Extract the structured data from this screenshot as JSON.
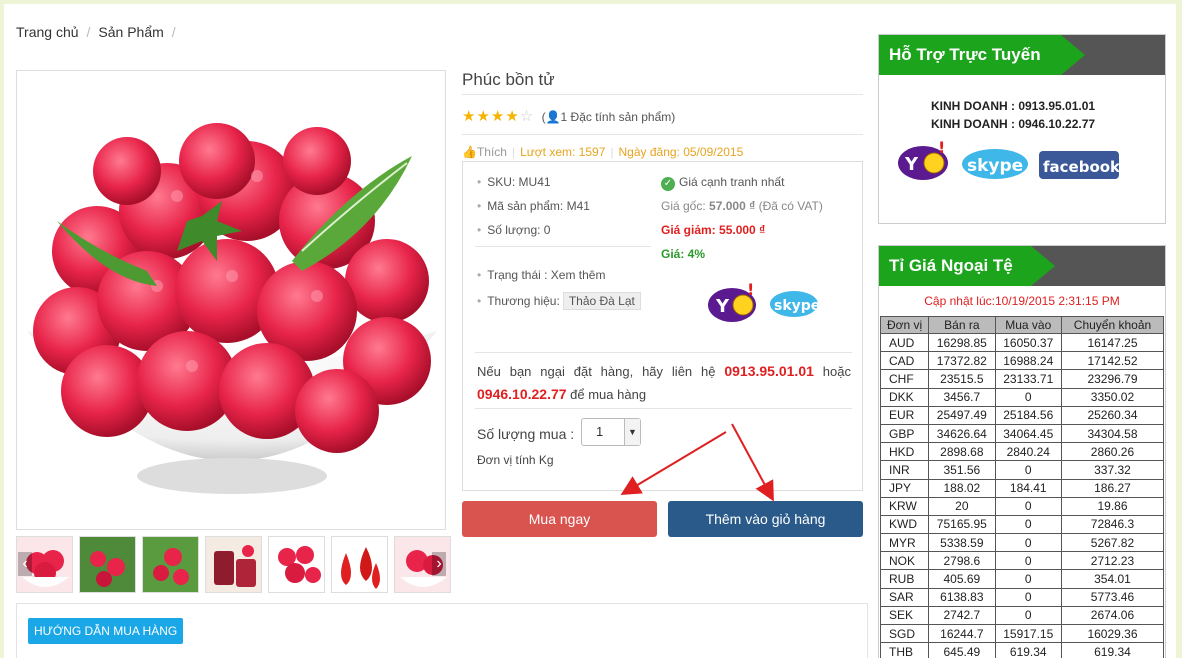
{
  "breadcrumb": {
    "home": "Trang chủ",
    "products": "Sản Phẩm",
    "sep": "/"
  },
  "product": {
    "title": "Phúc bồn tử",
    "rating": 4,
    "rating_text": "1 Đặc tính sản phẩm",
    "like": "Thích",
    "views": "Lượt xem: 1597",
    "date": "Ngày đăng: 05/09/2015",
    "sku": "SKU: MU41",
    "code": "Mã sản phẩm: M41",
    "stock": "Số lượng: 0",
    "status": "Trạng thái : Xem thêm",
    "brand_label": "Thương hiệu:",
    "brand": "Thảo Đà Lạt",
    "competitive": "Giá cạnh tranh nhất",
    "price_old_label": "Giá gốc:",
    "price_old": "57.000 ₫",
    "vat": "(Đã có VAT)",
    "price_new_label": "Giá giảm:",
    "price_new": "55.000 ₫",
    "discount": "Giá: 4%",
    "contact_pre": "Nếu bạn ngại đặt hàng, hãy liên hệ",
    "phone1": "0913.95.01.01",
    "contact_or": "hoặc",
    "phone2": "0946.10.22.77",
    "contact_post": "để mua hàng",
    "qty_label": "Số lượng mua :",
    "qty_value": "1",
    "unit": "Đơn vị tính  Kg",
    "buy_label": "Mua ngay",
    "cart_label": "Thêm vào giỏ hàng",
    "guide_label": "HƯỚNG DẪN MUA HÀNG"
  },
  "support": {
    "title": "Hỗ Trợ Trực Tuyến",
    "lines": [
      "KINH DOANH  : 0913.95.01.01",
      "KINH DOANH  : 0946.10.22.77"
    ],
    "logos": [
      "Y!",
      "skype",
      "facebook"
    ]
  },
  "fx": {
    "title": "Tỉ Giá Ngoại Tệ",
    "updated": "Cập nhật lúc:10/19/2015 2:31:15 PM",
    "headers": [
      "Đơn vị",
      "Bán ra",
      "Mua vào",
      "Chuyển khoản"
    ],
    "rows": [
      [
        "AUD",
        "16298.85",
        "16050.37",
        "16147.25"
      ],
      [
        "CAD",
        "17372.82",
        "16988.24",
        "17142.52"
      ],
      [
        "CHF",
        "23515.5",
        "23133.71",
        "23296.79"
      ],
      [
        "DKK",
        "3456.7",
        "0",
        "3350.02"
      ],
      [
        "EUR",
        "25497.49",
        "25184.56",
        "25260.34"
      ],
      [
        "GBP",
        "34626.64",
        "34064.45",
        "34304.58"
      ],
      [
        "HKD",
        "2898.68",
        "2840.24",
        "2860.26"
      ],
      [
        "INR",
        "351.56",
        "0",
        "337.32"
      ],
      [
        "JPY",
        "188.02",
        "184.41",
        "186.27"
      ],
      [
        "KRW",
        "20",
        "0",
        "19.86"
      ],
      [
        "KWD",
        "75165.95",
        "0",
        "72846.3"
      ],
      [
        "MYR",
        "5338.59",
        "0",
        "5267.82"
      ],
      [
        "NOK",
        "2798.6",
        "0",
        "2712.23"
      ],
      [
        "RUB",
        "405.69",
        "0",
        "354.01"
      ],
      [
        "SAR",
        "6138.83",
        "0",
        "5773.46"
      ],
      [
        "SEK",
        "2742.7",
        "0",
        "2674.06"
      ],
      [
        "SGD",
        "16244.7",
        "15917.15",
        "16029.36"
      ],
      [
        "THB",
        "645.49",
        "619.34",
        "619.34"
      ]
    ]
  },
  "colors": {
    "accent_green": "#1ca51c",
    "price_red": "#e02020",
    "buy_red": "#d9534f",
    "cart_blue": "#2a5a8a"
  }
}
